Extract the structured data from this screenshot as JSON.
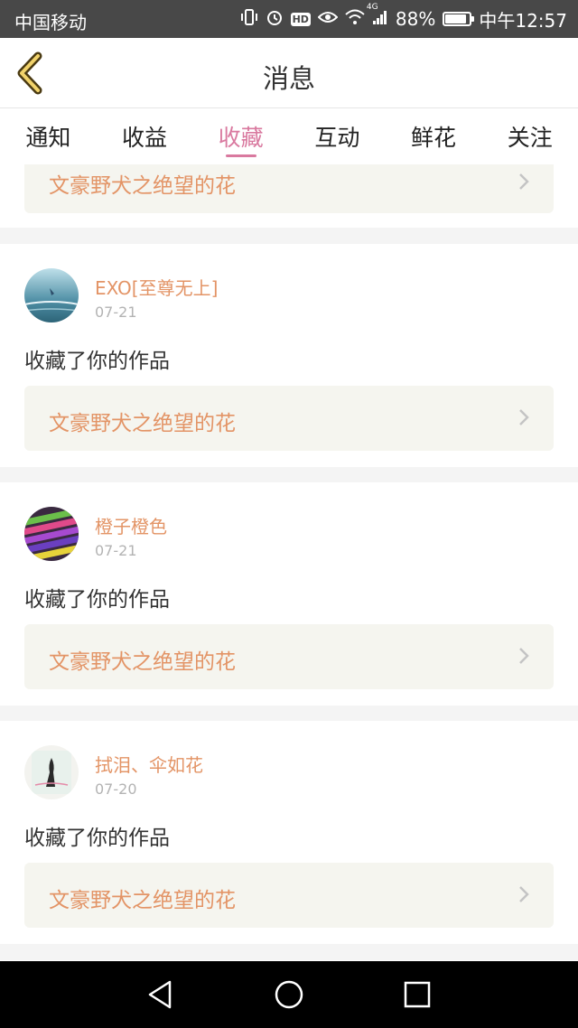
{
  "status_bar": {
    "carrier": "中国移动",
    "battery_percent": "88%",
    "battery_level": 0.88,
    "time": "中午12:57",
    "hd_label": "HD",
    "network_label": "4G"
  },
  "header": {
    "title": "消息"
  },
  "tabs": [
    {
      "label": "通知"
    },
    {
      "label": "收益"
    },
    {
      "label": "收藏",
      "active": true
    },
    {
      "label": "互动"
    },
    {
      "label": "鲜花"
    },
    {
      "label": "关注"
    }
  ],
  "partial_card": {
    "work_title": "文豪野犬之绝望的花"
  },
  "items": [
    {
      "username": "EXO[至尊无上]",
      "date": "07-21",
      "action": "收藏了你的作品",
      "work_title": "文豪野犬之绝望的花"
    },
    {
      "username": "橙子橙色",
      "date": "07-21",
      "action": "收藏了你的作品",
      "work_title": "文豪野犬之绝望的花"
    },
    {
      "username": "拭泪、伞如花",
      "date": "07-20",
      "action": "收藏了你的作品",
      "work_title": "文豪野犬之绝望的花"
    }
  ],
  "colors": {
    "accent": "#d9799f",
    "link": "#e39466",
    "status_bar": "#484848"
  },
  "icons": [
    "back-arrow-icon",
    "chevron-right-icon",
    "nav-back-icon",
    "nav-home-icon",
    "nav-recents-icon"
  ]
}
